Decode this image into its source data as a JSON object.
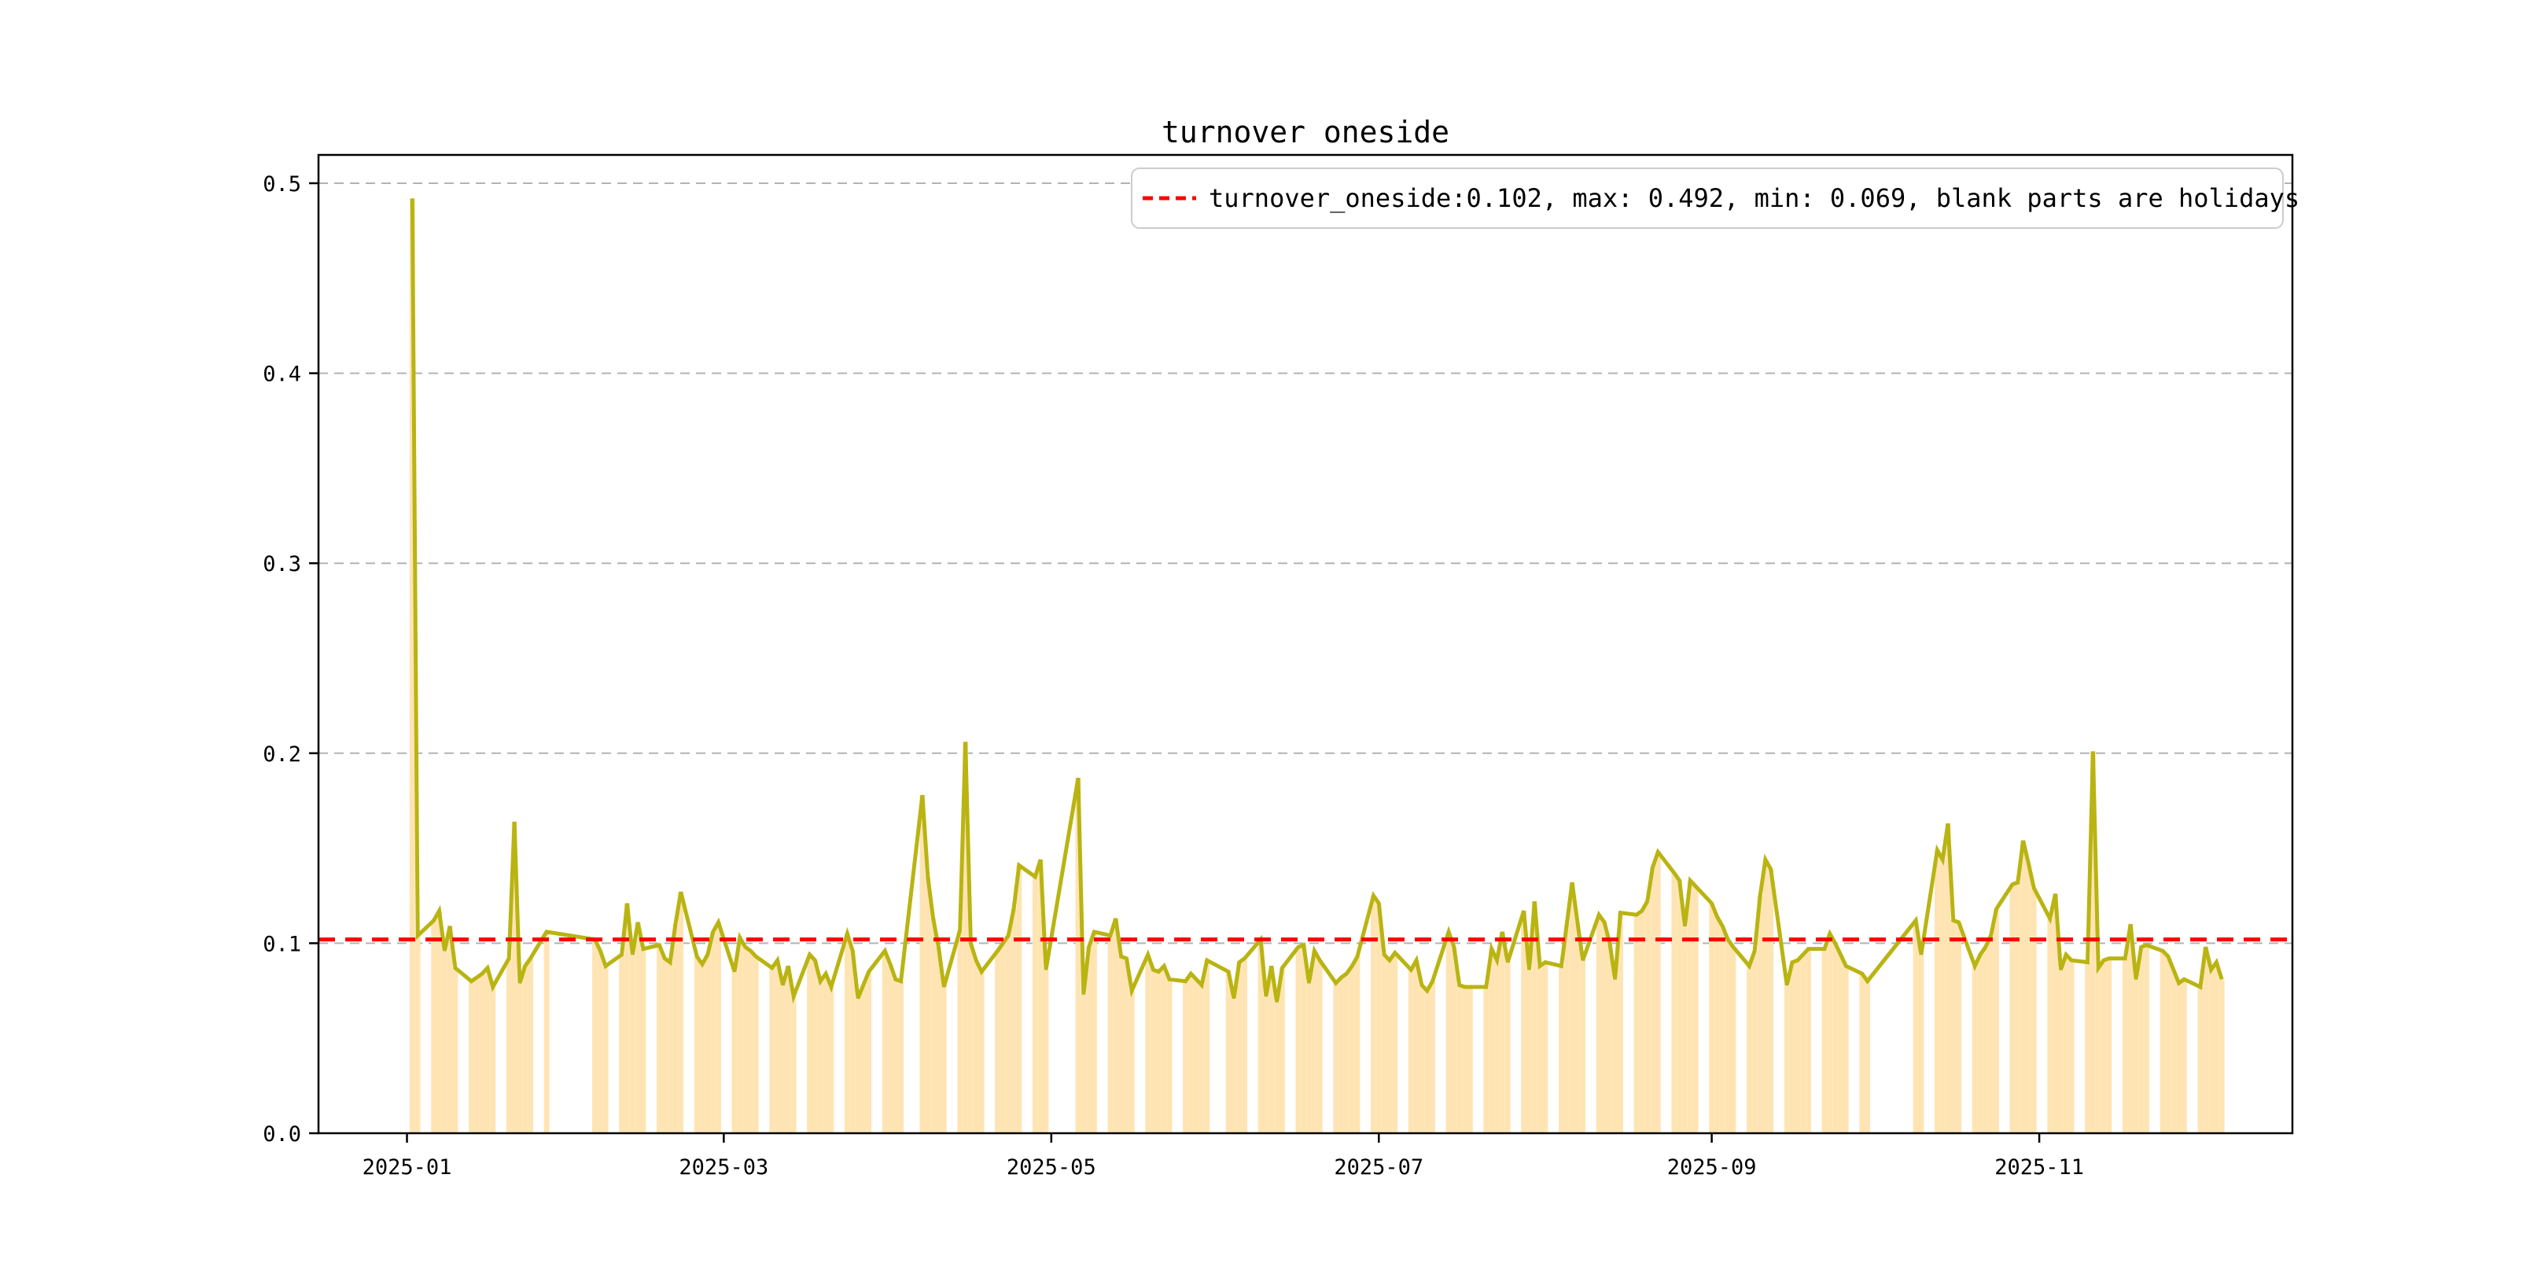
{
  "figure": {
    "background": "#ffffff",
    "frame_color": "#000000"
  },
  "chart_data": {
    "type": "line",
    "title": "turnover oneside",
    "legend": {
      "position": "upper right",
      "entries": [
        {
          "label": "turnover_oneside:0.102, max: 0.492, min: 0.069, blank parts are holidays",
          "line_color": "#ff0000",
          "line_style": "dashed"
        }
      ]
    },
    "stats": {
      "mean": 0.102,
      "max": 0.492,
      "min": 0.069
    },
    "mean_line": {
      "value": 0.102,
      "color": "#ff0000",
      "style": "dashed"
    },
    "grid": {
      "on": true,
      "color": "#b3b3b3",
      "style": "dashed"
    },
    "y_axis": {
      "ticks": [
        0.0,
        0.1,
        0.2,
        0.3,
        0.4,
        0.5
      ],
      "tick_labels": [
        "0.0",
        "0.1",
        "0.2",
        "0.3",
        "0.4",
        "0.5"
      ],
      "limit": [
        0,
        0.516
      ]
    },
    "x_axis": {
      "tick_dates": [
        "2025-01-01",
        "2025-03-01",
        "2025-05-01",
        "2025-07-01",
        "2025-09-01",
        "2025-11-01"
      ],
      "tick_labels": [
        "2025-01",
        "2025-03",
        "2025-05",
        "2025-07",
        "2025-09",
        "2025-11"
      ],
      "limit_dates": [
        "2024-12-15",
        "2025-12-18"
      ],
      "note": "blank parts are holidays"
    },
    "series": [
      {
        "name": "turnover_oneside",
        "line_color": "#b9b412",
        "bar_color": "#ffe4b3",
        "points": [
          [
            "2025-01-02",
            0.492
          ],
          [
            "2025-01-03",
            0.104
          ],
          [
            "2025-01-06",
            0.112
          ],
          [
            "2025-01-07",
            0.117
          ],
          [
            "2025-01-08",
            0.096
          ],
          [
            "2025-01-09",
            0.109
          ],
          [
            "2025-01-10",
            0.087
          ],
          [
            "2025-01-13",
            0.08
          ],
          [
            "2025-01-14",
            0.082
          ],
          [
            "2025-01-15",
            0.084
          ],
          [
            "2025-01-16",
            0.087
          ],
          [
            "2025-01-17",
            0.077
          ],
          [
            "2025-01-20",
            0.092
          ],
          [
            "2025-01-21",
            0.164
          ],
          [
            "2025-01-22",
            0.079
          ],
          [
            "2025-01-23",
            0.088
          ],
          [
            "2025-01-24",
            0.092
          ],
          [
            "2025-01-27",
            0.106
          ],
          [
            "2025-02-05",
            0.102
          ],
          [
            "2025-02-06",
            0.096
          ],
          [
            "2025-02-07",
            0.088
          ],
          [
            "2025-02-10",
            0.094
          ],
          [
            "2025-02-11",
            0.121
          ],
          [
            "2025-02-12",
            0.094
          ],
          [
            "2025-02-13",
            0.111
          ],
          [
            "2025-02-14",
            0.097
          ],
          [
            "2025-02-17",
            0.099
          ],
          [
            "2025-02-18",
            0.092
          ],
          [
            "2025-02-19",
            0.09
          ],
          [
            "2025-02-20",
            0.11
          ],
          [
            "2025-02-21",
            0.127
          ],
          [
            "2025-02-24",
            0.093
          ],
          [
            "2025-02-25",
            0.089
          ],
          [
            "2025-02-26",
            0.094
          ],
          [
            "2025-02-27",
            0.106
          ],
          [
            "2025-02-28",
            0.111
          ],
          [
            "2025-03-03",
            0.085
          ],
          [
            "2025-03-04",
            0.103
          ],
          [
            "2025-03-05",
            0.098
          ],
          [
            "2025-03-06",
            0.096
          ],
          [
            "2025-03-07",
            0.093
          ],
          [
            "2025-03-10",
            0.087
          ],
          [
            "2025-03-11",
            0.091
          ],
          [
            "2025-03-12",
            0.078
          ],
          [
            "2025-03-13",
            0.088
          ],
          [
            "2025-03-14",
            0.072
          ],
          [
            "2025-03-17",
            0.094
          ],
          [
            "2025-03-18",
            0.091
          ],
          [
            "2025-03-19",
            0.08
          ],
          [
            "2025-03-20",
            0.084
          ],
          [
            "2025-03-21",
            0.077
          ],
          [
            "2025-03-24",
            0.105
          ],
          [
            "2025-03-25",
            0.096
          ],
          [
            "2025-03-26",
            0.071
          ],
          [
            "2025-03-27",
            0.078
          ],
          [
            "2025-03-28",
            0.085
          ],
          [
            "2025-03-31",
            0.096
          ],
          [
            "2025-04-01",
            0.089
          ],
          [
            "2025-04-02",
            0.081
          ],
          [
            "2025-04-03",
            0.08
          ],
          [
            "2025-04-07",
            0.178
          ],
          [
            "2025-04-08",
            0.135
          ],
          [
            "2025-04-09",
            0.113
          ],
          [
            "2025-04-10",
            0.098
          ],
          [
            "2025-04-11",
            0.077
          ],
          [
            "2025-04-14",
            0.107
          ],
          [
            "2025-04-15",
            0.206
          ],
          [
            "2025-04-16",
            0.1
          ],
          [
            "2025-04-17",
            0.091
          ],
          [
            "2025-04-18",
            0.085
          ],
          [
            "2025-04-21",
            0.096
          ],
          [
            "2025-04-22",
            0.1
          ],
          [
            "2025-04-23",
            0.104
          ],
          [
            "2025-04-24",
            0.118
          ],
          [
            "2025-04-25",
            0.141
          ],
          [
            "2025-04-28",
            0.135
          ],
          [
            "2025-04-29",
            0.144
          ],
          [
            "2025-04-30",
            0.086
          ],
          [
            "2025-05-06",
            0.187
          ],
          [
            "2025-05-07",
            0.073
          ],
          [
            "2025-05-08",
            0.098
          ],
          [
            "2025-05-09",
            0.106
          ],
          [
            "2025-05-12",
            0.104
          ],
          [
            "2025-05-13",
            0.113
          ],
          [
            "2025-05-14",
            0.093
          ],
          [
            "2025-05-15",
            0.092
          ],
          [
            "2025-05-16",
            0.075
          ],
          [
            "2025-05-19",
            0.094
          ],
          [
            "2025-05-20",
            0.086
          ],
          [
            "2025-05-21",
            0.085
          ],
          [
            "2025-05-22",
            0.088
          ],
          [
            "2025-05-23",
            0.081
          ],
          [
            "2025-05-26",
            0.08
          ],
          [
            "2025-05-27",
            0.084
          ],
          [
            "2025-05-28",
            0.081
          ],
          [
            "2025-05-29",
            0.078
          ],
          [
            "2025-05-30",
            0.091
          ],
          [
            "2025-06-03",
            0.085
          ],
          [
            "2025-06-04",
            0.071
          ],
          [
            "2025-06-05",
            0.09
          ],
          [
            "2025-06-06",
            0.092
          ],
          [
            "2025-06-09",
            0.102
          ],
          [
            "2025-06-10",
            0.072
          ],
          [
            "2025-06-11",
            0.088
          ],
          [
            "2025-06-12",
            0.069
          ],
          [
            "2025-06-13",
            0.087
          ],
          [
            "2025-06-16",
            0.098
          ],
          [
            "2025-06-17",
            0.099
          ],
          [
            "2025-06-18",
            0.079
          ],
          [
            "2025-06-19",
            0.096
          ],
          [
            "2025-06-20",
            0.091
          ],
          [
            "2025-06-23",
            0.079
          ],
          [
            "2025-06-24",
            0.082
          ],
          [
            "2025-06-25",
            0.084
          ],
          [
            "2025-06-26",
            0.088
          ],
          [
            "2025-06-27",
            0.093
          ],
          [
            "2025-06-30",
            0.125
          ],
          [
            "2025-07-01",
            0.121
          ],
          [
            "2025-07-02",
            0.094
          ],
          [
            "2025-07-03",
            0.091
          ],
          [
            "2025-07-04",
            0.095
          ],
          [
            "2025-07-07",
            0.086
          ],
          [
            "2025-07-08",
            0.091
          ],
          [
            "2025-07-09",
            0.078
          ],
          [
            "2025-07-10",
            0.075
          ],
          [
            "2025-07-11",
            0.08
          ],
          [
            "2025-07-14",
            0.106
          ],
          [
            "2025-07-15",
            0.098
          ],
          [
            "2025-07-16",
            0.078
          ],
          [
            "2025-07-17",
            0.077
          ],
          [
            "2025-07-18",
            0.077
          ],
          [
            "2025-07-21",
            0.077
          ],
          [
            "2025-07-22",
            0.097
          ],
          [
            "2025-07-23",
            0.091
          ],
          [
            "2025-07-24",
            0.106
          ],
          [
            "2025-07-25",
            0.09
          ],
          [
            "2025-07-28",
            0.117
          ],
          [
            "2025-07-29",
            0.086
          ],
          [
            "2025-07-30",
            0.122
          ],
          [
            "2025-07-31",
            0.088
          ],
          [
            "2025-08-01",
            0.09
          ],
          [
            "2025-08-04",
            0.088
          ],
          [
            "2025-08-05",
            0.11
          ],
          [
            "2025-08-06",
            0.132
          ],
          [
            "2025-08-07",
            0.111
          ],
          [
            "2025-08-08",
            0.091
          ],
          [
            "2025-08-11",
            0.115
          ],
          [
            "2025-08-12",
            0.111
          ],
          [
            "2025-08-13",
            0.1
          ],
          [
            "2025-08-14",
            0.081
          ],
          [
            "2025-08-15",
            0.116
          ],
          [
            "2025-08-18",
            0.115
          ],
          [
            "2025-08-19",
            0.117
          ],
          [
            "2025-08-20",
            0.122
          ],
          [
            "2025-08-21",
            0.14
          ],
          [
            "2025-08-22",
            0.148
          ],
          [
            "2025-08-25",
            0.137
          ],
          [
            "2025-08-26",
            0.133
          ],
          [
            "2025-08-27",
            0.109
          ],
          [
            "2025-08-28",
            0.133
          ],
          [
            "2025-08-29",
            0.13
          ],
          [
            "2025-09-01",
            0.121
          ],
          [
            "2025-09-02",
            0.114
          ],
          [
            "2025-09-03",
            0.109
          ],
          [
            "2025-09-04",
            0.102
          ],
          [
            "2025-09-05",
            0.098
          ],
          [
            "2025-09-08",
            0.088
          ],
          [
            "2025-09-09",
            0.096
          ],
          [
            "2025-09-10",
            0.125
          ],
          [
            "2025-09-11",
            0.144
          ],
          [
            "2025-09-12",
            0.139
          ],
          [
            "2025-09-15",
            0.078
          ],
          [
            "2025-09-16",
            0.09
          ],
          [
            "2025-09-17",
            0.091
          ],
          [
            "2025-09-18",
            0.094
          ],
          [
            "2025-09-19",
            0.097
          ],
          [
            "2025-09-22",
            0.097
          ],
          [
            "2025-09-23",
            0.105
          ],
          [
            "2025-09-24",
            0.1
          ],
          [
            "2025-09-25",
            0.094
          ],
          [
            "2025-09-26",
            0.088
          ],
          [
            "2025-09-29",
            0.084
          ],
          [
            "2025-09-30",
            0.08
          ],
          [
            "2025-10-09",
            0.112
          ],
          [
            "2025-10-10",
            0.094
          ],
          [
            "2025-10-13",
            0.149
          ],
          [
            "2025-10-14",
            0.144
          ],
          [
            "2025-10-15",
            0.163
          ],
          [
            "2025-10-16",
            0.112
          ],
          [
            "2025-10-17",
            0.111
          ],
          [
            "2025-10-20",
            0.088
          ],
          [
            "2025-10-21",
            0.094
          ],
          [
            "2025-10-22",
            0.098
          ],
          [
            "2025-10-23",
            0.104
          ],
          [
            "2025-10-24",
            0.118
          ],
          [
            "2025-10-27",
            0.131
          ],
          [
            "2025-10-28",
            0.132
          ],
          [
            "2025-10-29",
            0.154
          ],
          [
            "2025-10-30",
            0.142
          ],
          [
            "2025-10-31",
            0.129
          ],
          [
            "2025-11-03",
            0.113
          ],
          [
            "2025-11-04",
            0.126
          ],
          [
            "2025-11-05",
            0.086
          ],
          [
            "2025-11-06",
            0.094
          ],
          [
            "2025-11-07",
            0.091
          ],
          [
            "2025-11-10",
            0.09
          ],
          [
            "2025-11-11",
            0.201
          ],
          [
            "2025-11-12",
            0.087
          ],
          [
            "2025-11-13",
            0.091
          ],
          [
            "2025-11-14",
            0.092
          ],
          [
            "2025-11-17",
            0.092
          ],
          [
            "2025-11-18",
            0.11
          ],
          [
            "2025-11-19",
            0.081
          ],
          [
            "2025-11-20",
            0.098
          ],
          [
            "2025-11-21",
            0.099
          ],
          [
            "2025-11-24",
            0.096
          ],
          [
            "2025-11-25",
            0.093
          ],
          [
            "2025-11-26",
            0.086
          ],
          [
            "2025-11-27",
            0.079
          ],
          [
            "2025-11-28",
            0.081
          ],
          [
            "2025-12-01",
            0.077
          ],
          [
            "2025-12-02",
            0.098
          ],
          [
            "2025-12-03",
            0.086
          ],
          [
            "2025-12-04",
            0.09
          ],
          [
            "2025-12-05",
            0.081
          ]
        ]
      }
    ]
  }
}
